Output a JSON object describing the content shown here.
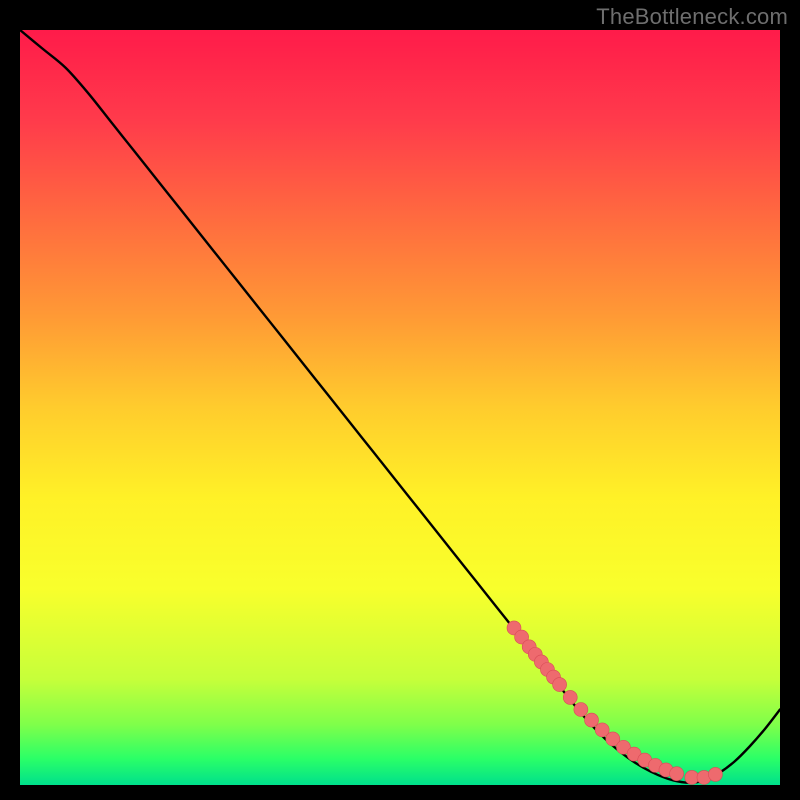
{
  "watermark": "TheBottleneck.com",
  "colors": {
    "background_black": "#000000",
    "curve": "#000000",
    "marker_fill": "#ee6a6e",
    "marker_stroke": "#d94c57",
    "gradient_stops": [
      {
        "offset": 0.0,
        "color": "#ff1b4a"
      },
      {
        "offset": 0.12,
        "color": "#ff3b4b"
      },
      {
        "offset": 0.25,
        "color": "#ff6b3f"
      },
      {
        "offset": 0.38,
        "color": "#ff9a35"
      },
      {
        "offset": 0.5,
        "color": "#ffcc2d"
      },
      {
        "offset": 0.62,
        "color": "#fff127"
      },
      {
        "offset": 0.74,
        "color": "#f8ff2c"
      },
      {
        "offset": 0.86,
        "color": "#c6ff3a"
      },
      {
        "offset": 0.92,
        "color": "#7fff4a"
      },
      {
        "offset": 0.965,
        "color": "#2bff67"
      },
      {
        "offset": 1.0,
        "color": "#00e08c"
      }
    ]
  },
  "chart_data": {
    "type": "line",
    "title": "",
    "xlabel": "",
    "ylabel": "",
    "xlim": [
      0,
      100
    ],
    "ylim": [
      0,
      100
    ],
    "grid": false,
    "legend": false,
    "series": [
      {
        "name": "bottleneck-curve",
        "x": [
          0,
          3,
          6,
          9,
          12,
          15,
          18,
          21,
          24,
          27,
          30,
          33,
          36,
          39,
          42,
          45,
          48,
          51,
          54,
          57,
          60,
          63,
          66,
          68,
          70,
          72,
          74,
          76,
          78,
          80,
          82,
          84,
          86,
          88,
          90,
          92,
          94,
          96,
          98,
          100
        ],
        "y": [
          100,
          97.5,
          95.0,
          91.6,
          87.8,
          84.0,
          80.2,
          76.4,
          72.6,
          68.8,
          65.0,
          61.2,
          57.4,
          53.6,
          49.8,
          46.0,
          42.2,
          38.4,
          34.6,
          30.8,
          27.0,
          23.2,
          19.4,
          16.9,
          14.3,
          11.8,
          9.3,
          7.1,
          5.2,
          3.6,
          2.3,
          1.3,
          0.6,
          0.3,
          0.6,
          1.6,
          3.1,
          5.1,
          7.4,
          10.0
        ]
      }
    ],
    "markers": {
      "name": "highlight-points",
      "x": [
        65.0,
        66.0,
        67.0,
        67.8,
        68.6,
        69.4,
        70.2,
        71.0,
        72.4,
        73.8,
        75.2,
        76.6,
        78.0,
        79.4,
        80.8,
        82.2,
        83.6,
        85.0,
        86.4,
        88.4,
        90.0,
        91.5
      ],
      "y": [
        20.8,
        19.6,
        18.3,
        17.3,
        16.3,
        15.3,
        14.3,
        13.3,
        11.6,
        10.0,
        8.6,
        7.3,
        6.1,
        5.0,
        4.1,
        3.3,
        2.6,
        2.0,
        1.5,
        1.0,
        1.0,
        1.4
      ]
    }
  }
}
